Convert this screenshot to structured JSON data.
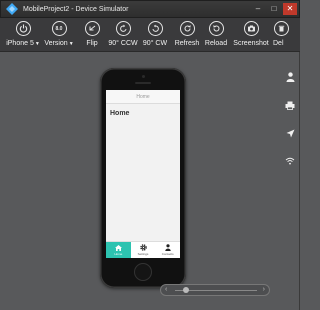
{
  "window": {
    "title": "MobileProject2 - Device Simulator"
  },
  "toolbar": {
    "device_label": "iPhone 5",
    "version_label": "Version",
    "version_icon_text": "8.0",
    "flip_label": "Flip",
    "ccw_label": "90° CCW",
    "cw_label": "90° CW",
    "refresh_label": "Refresh",
    "reload_label": "Reload",
    "screenshot_label": "Screenshot",
    "delete_label": "Del"
  },
  "phone": {
    "nav_title": "Home",
    "heading": "Home",
    "tabs": [
      {
        "label": "Home",
        "icon": "home-icon",
        "active": true
      },
      {
        "label": "Settings",
        "icon": "gear-icon",
        "active": false
      },
      {
        "label": "Contacts",
        "icon": "person-icon",
        "active": false
      }
    ]
  },
  "sidebar": {
    "icons": [
      "person-icon",
      "printer-icon",
      "location-arrow-icon",
      "wifi-icon"
    ]
  },
  "colors": {
    "background": "#58595b",
    "toolbar": "#3a3a3c",
    "accent": "#2dc3b0",
    "app_icon": "#3fa9f5",
    "close": "#c0392b"
  }
}
